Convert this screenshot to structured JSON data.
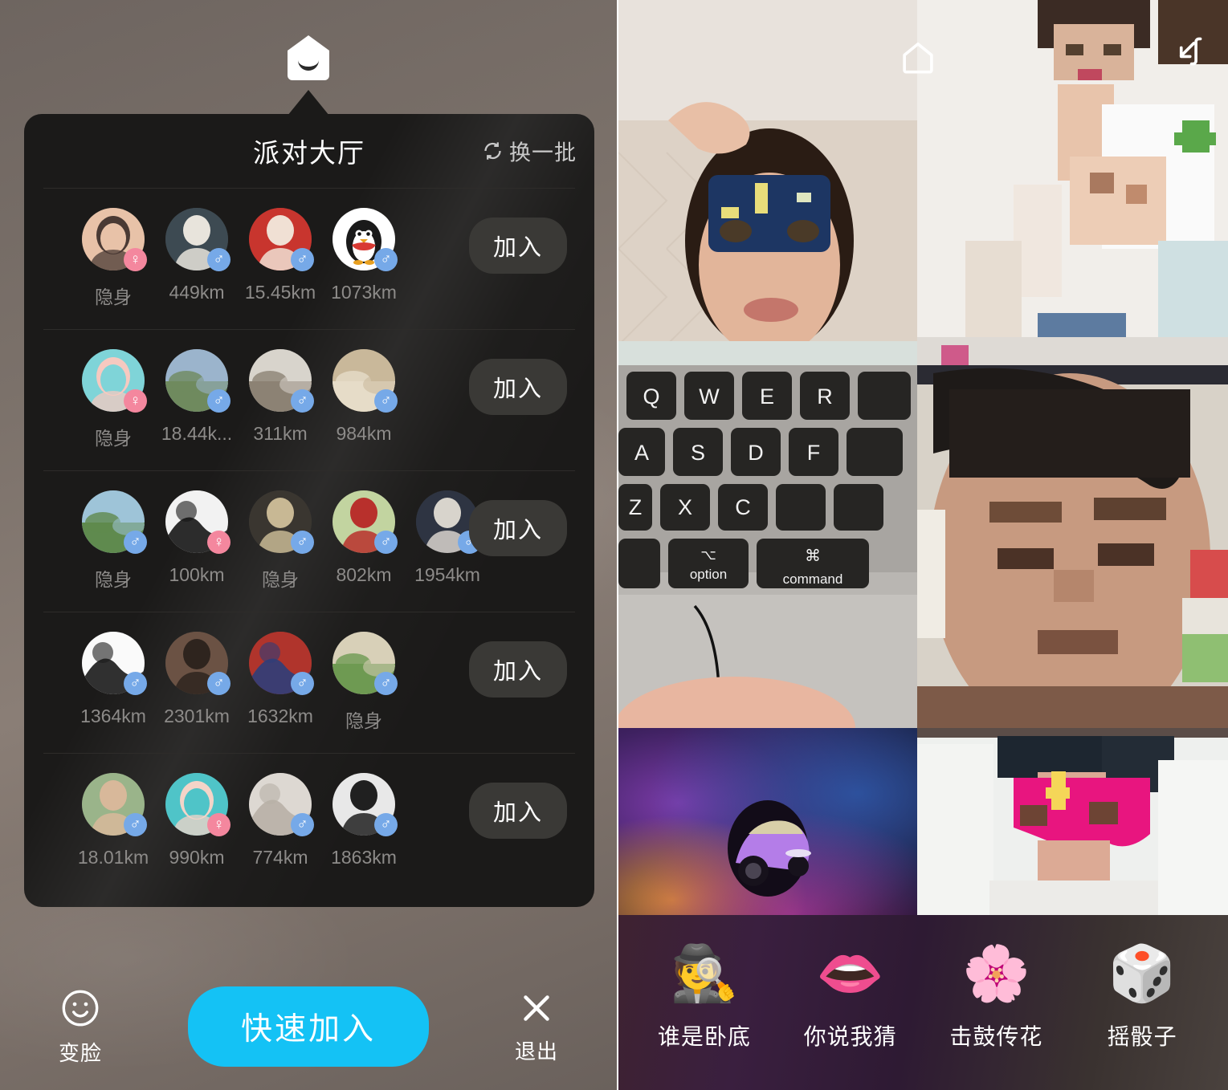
{
  "left_panel": {
    "home_icon": "house-smile-icon",
    "card": {
      "title": "派对大厅",
      "refresh": {
        "icon": "refresh-icon",
        "label": "换一批"
      },
      "join_label": "加入",
      "hidden_label": "隐身",
      "rows": [
        {
          "join_label": "加入",
          "members": [
            {
              "distance": "隐身",
              "gender": "female",
              "gender_glyph": "♀",
              "avatar": "masked-person"
            },
            {
              "distance": "449km",
              "gender": "male",
              "gender_glyph": "♂",
              "avatar": "man-white-shirt"
            },
            {
              "distance": "15.45km",
              "gender": "male",
              "gender_glyph": "♂",
              "avatar": "man-red-polo"
            },
            {
              "distance": "1073km",
              "gender": "male",
              "gender_glyph": "♂",
              "avatar": "qq-penguin"
            }
          ]
        },
        {
          "join_label": "加入",
          "members": [
            {
              "distance": "隐身",
              "gender": "female",
              "gender_glyph": "♀",
              "avatar": "girl-cat-filter"
            },
            {
              "distance": "18.44k...",
              "gender": "male",
              "gender_glyph": "♂",
              "avatar": "street-car-scene"
            },
            {
              "distance": "311km",
              "gender": "male",
              "gender_glyph": "♂",
              "avatar": "rock-landscape"
            },
            {
              "distance": "984km",
              "gender": "male",
              "gender_glyph": "♂",
              "avatar": "chandelier-room"
            }
          ]
        },
        {
          "join_label": "加入",
          "members": [
            {
              "distance": "隐身",
              "gender": "male",
              "gender_glyph": "♂",
              "avatar": "riverside-park"
            },
            {
              "distance": "100km",
              "gender": "female",
              "gender_glyph": "♀",
              "avatar": "bw-abstract"
            },
            {
              "distance": "隐身",
              "gender": "male",
              "gender_glyph": "♂",
              "avatar": "man-standing-night"
            },
            {
              "distance": "802km",
              "gender": "male",
              "gender_glyph": "♂",
              "avatar": "red-portrait"
            },
            {
              "distance": "1954km",
              "gender": "male",
              "gender_glyph": "♂",
              "avatar": "couple-photo"
            }
          ]
        },
        {
          "join_label": "加入",
          "members": [
            {
              "distance": "1364km",
              "gender": "male",
              "gender_glyph": "♂",
              "avatar": "sketch-face"
            },
            {
              "distance": "2301km",
              "gender": "male",
              "gender_glyph": "♂",
              "avatar": "young-man-dark"
            },
            {
              "distance": "1632km",
              "gender": "male",
              "gender_glyph": "♂",
              "avatar": "colorful-figure"
            },
            {
              "distance": "隐身",
              "gender": "male",
              "gender_glyph": "♂",
              "avatar": "garden-walk"
            }
          ]
        },
        {
          "join_label": "加入",
          "members": [
            {
              "distance": "18.01km",
              "gender": "male",
              "gender_glyph": "♂",
              "avatar": "man-glasses"
            },
            {
              "distance": "990km",
              "gender": "female",
              "gender_glyph": "♀",
              "avatar": "girl-teal-hair"
            },
            {
              "distance": "774km",
              "gender": "male",
              "gender_glyph": "♂",
              "avatar": "pale-object"
            },
            {
              "distance": "1863km",
              "gender": "male",
              "gender_glyph": "♂",
              "avatar": "bw-man-portrait"
            }
          ]
        }
      ]
    },
    "bottom_bar": {
      "face_icon": "smiley-face-icon",
      "face_label": "变脸",
      "quick_join_label": "快速加入",
      "exit_icon": "close-x-icon",
      "exit_label": "退出"
    }
  },
  "right_panel": {
    "home_icon": "home-outline-icon",
    "collapse_icon": "collapse-arrow-icon",
    "video_tiles": [
      {
        "position": "top-left",
        "content": "masked-man-on-bed"
      },
      {
        "position": "top-right",
        "content": "woman-pixelated"
      },
      {
        "position": "middle-left",
        "content": "macbook-keyboard"
      },
      {
        "position": "middle-right",
        "content": "man-face-pixelated"
      },
      {
        "position": "bottom-left",
        "content": "purple-car-avatar"
      },
      {
        "position": "bottom-right",
        "content": "pink-mask-face"
      }
    ],
    "games": [
      {
        "emoji": "🕵",
        "icon": "spy-icon",
        "label": "谁是卧底"
      },
      {
        "emoji": "👄",
        "icon": "lips-icon",
        "label": "你说我猜"
      },
      {
        "emoji": "🌸",
        "icon": "flower-icon",
        "label": "击鼓传花"
      },
      {
        "emoji": "🎲",
        "icon": "dice-icon",
        "label": "摇骰子"
      }
    ]
  },
  "colors": {
    "accent_blue": "#14c2f5",
    "male_badge": "#76a9e8",
    "female_badge": "#f4879e",
    "card_bg": "#1b1a19",
    "join_button": "#3a3936"
  }
}
